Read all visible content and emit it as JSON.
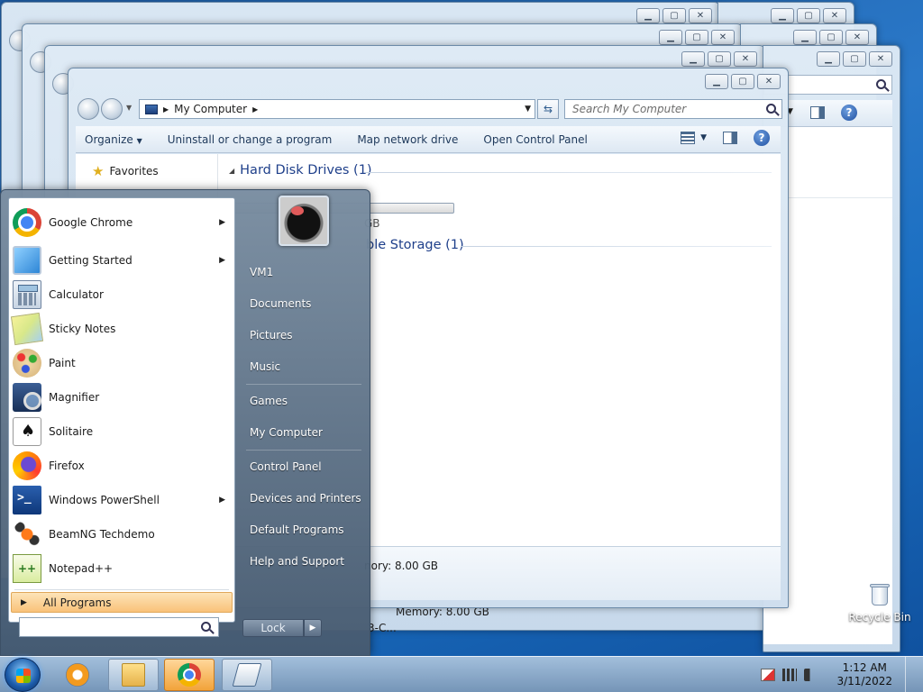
{
  "explorer": {
    "address": "My Computer",
    "search_placeholder": "Search My Computer",
    "commands": [
      "Organize",
      "Uninstall or change a program",
      "Map network drive",
      "Open Control Panel"
    ],
    "nav": {
      "favorites": "Favorites"
    },
    "groups": {
      "hard_disk": "Hard Disk Drives (1)",
      "removable_fragment": "ble Storage (1)"
    },
    "drive_free_fragment": "GB",
    "details_memory": "Memory: 8.00 GB",
    "details_memory_fragment": "nory: 8.00 GB",
    "lower_memory": "Memory: 8.00 GB",
    "lower_frag": "3-C..."
  },
  "start_menu": {
    "programs": [
      {
        "label": "Google Chrome",
        "icon": "chrome-icon",
        "submenu": true
      },
      {
        "label": "Getting Started",
        "icon": "getting-started-icon",
        "submenu": true
      },
      {
        "label": "Calculator",
        "icon": "calculator-icon",
        "submenu": false
      },
      {
        "label": "Sticky Notes",
        "icon": "sticky-notes-icon",
        "submenu": false
      },
      {
        "label": "Paint",
        "icon": "paint-icon",
        "submenu": false
      },
      {
        "label": "Magnifier",
        "icon": "magnifier-icon",
        "submenu": false
      },
      {
        "label": "Solitaire",
        "icon": "solitaire-icon",
        "submenu": false
      },
      {
        "label": "Firefox",
        "icon": "firefox-icon",
        "submenu": false
      },
      {
        "label": "Windows PowerShell",
        "icon": "powershell-icon",
        "submenu": true
      },
      {
        "label": "BeamNG Techdemo",
        "icon": "beamng-icon",
        "submenu": false
      },
      {
        "label": "Notepad++",
        "icon": "notepad-plus-plus-icon",
        "submenu": false
      }
    ],
    "all_programs": "All Programs",
    "right_links": [
      "VM1",
      "Documents",
      "Pictures",
      "Music",
      "Games",
      "My Computer",
      "Control Panel",
      "Devices and Printers",
      "Default Programs",
      "Help and Support"
    ],
    "lock_label": "Lock"
  },
  "desktop": {
    "recycle_bin": "Recycle Bin"
  },
  "taskbar": {
    "time": "1:12 AM",
    "date": "3/11/2022"
  }
}
